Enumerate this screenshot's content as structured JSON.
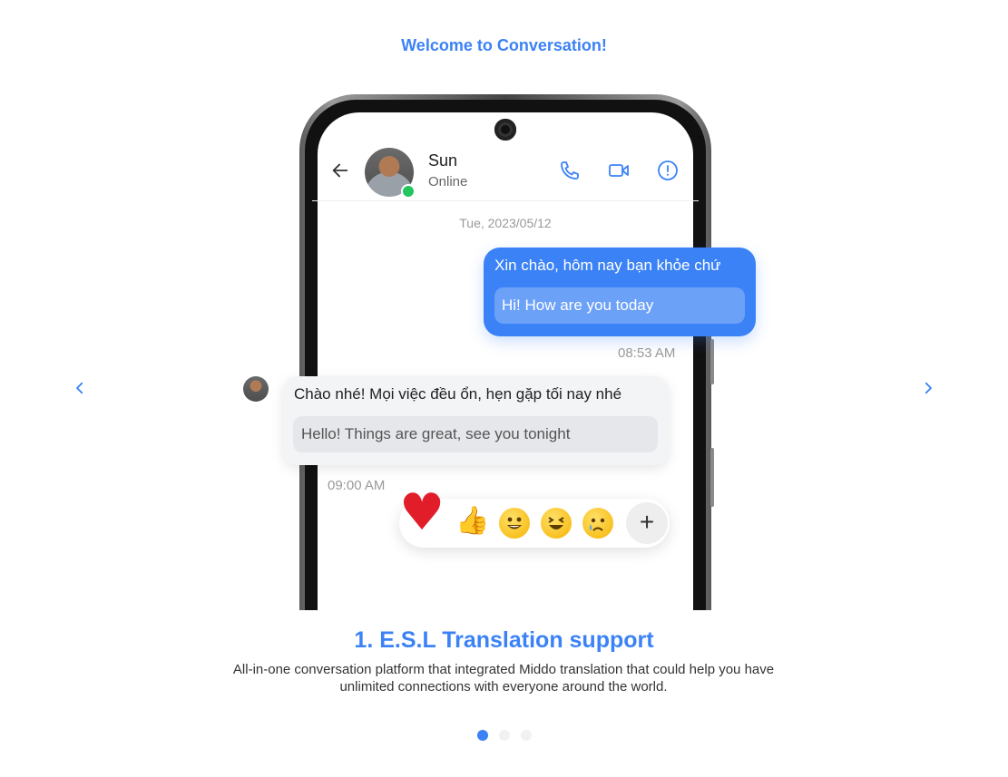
{
  "header": {
    "welcome": "Welcome to Conversation!"
  },
  "carousel": {
    "prev_icon": "chevron-left-icon",
    "next_icon": "chevron-right-icon",
    "active_index": 0,
    "dots": 3
  },
  "chat": {
    "contact": {
      "name": "Sun",
      "status": "Online"
    },
    "date": "Tue, 2023/05/12",
    "messages": [
      {
        "direction": "outgoing",
        "original": "Xin chào, hôm nay bạn khỏe chứ",
        "translation": "Hi! How are you today",
        "time": "08:53 AM"
      },
      {
        "direction": "incoming",
        "original": "Chào nhé! Mọi việc đều ổn, hẹn gặp tối nay nhé",
        "translation": "Hello! Things are great, see you tonight",
        "time": "09:00 AM"
      }
    ],
    "reactions": [
      "heart",
      "thumbs-up",
      "grinning-face",
      "laughing-face",
      "crying-face",
      "add"
    ],
    "add_reaction_label": "+"
  },
  "slide": {
    "title": "1. E.S.L Translation support",
    "description": "All-in-one conversation platform that integrated Middo translation that could help you have unlimited connections with everyone around the world."
  },
  "colors": {
    "accent": "#3b82f6",
    "online": "#22c55e"
  }
}
